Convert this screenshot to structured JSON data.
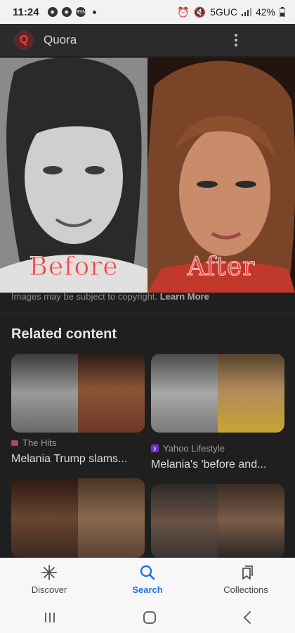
{
  "status_bar": {
    "time": "11:24",
    "network": "5GUC",
    "battery": "42%"
  },
  "header": {
    "site_name": "Quora",
    "logo_letter": "Q"
  },
  "hero": {
    "before_label": "Before",
    "after_label": "After",
    "copyright_text": "Images may be subject to copyright.",
    "learn_more": "Learn More"
  },
  "related": {
    "title": "Related content",
    "cards": [
      {
        "source": "The Hits",
        "title": "Melania Trump slams..."
      },
      {
        "source": "Yahoo Lifestyle",
        "title": "Melania's 'before and..."
      }
    ]
  },
  "bottom_nav": {
    "items": [
      {
        "label": "Discover"
      },
      {
        "label": "Search"
      },
      {
        "label": "Collections"
      }
    ]
  },
  "colors": {
    "accent": "#1a73e8",
    "label_red": "#e9413f"
  }
}
